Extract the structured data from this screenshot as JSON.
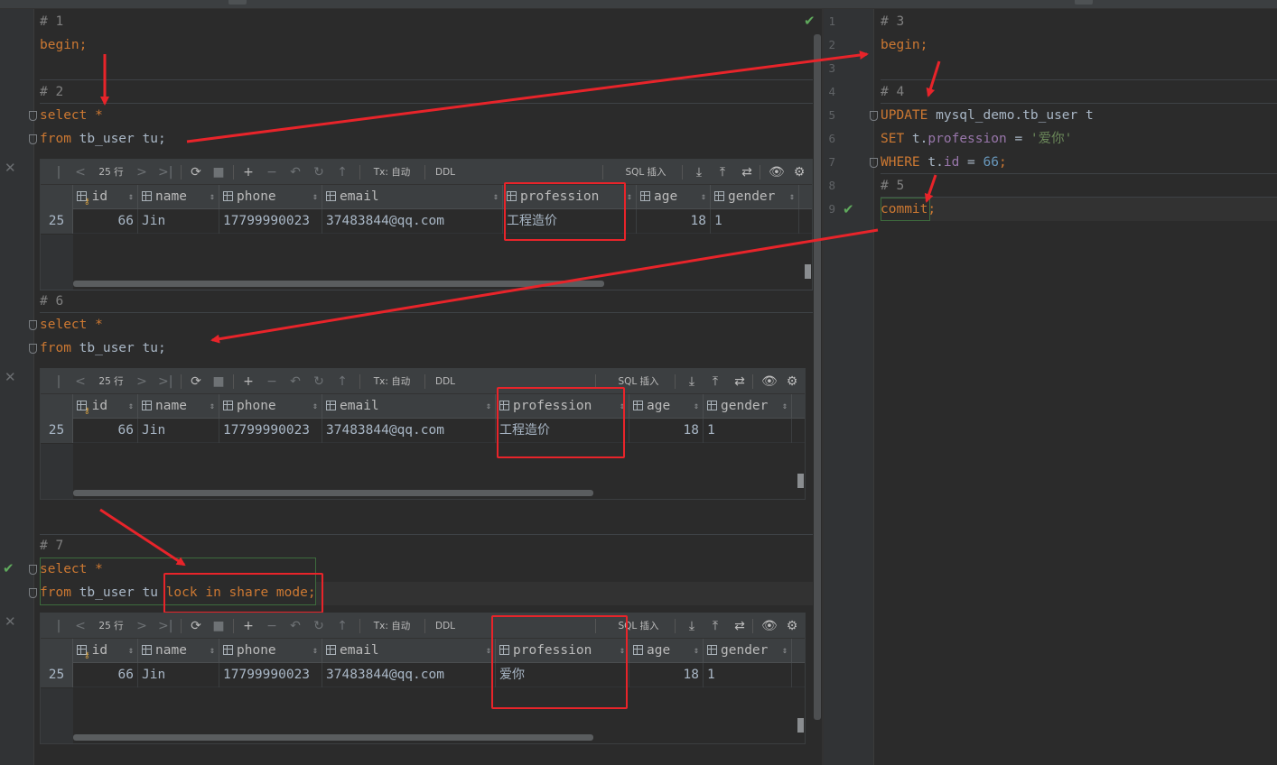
{
  "editor_left": {
    "block1": {
      "comment": "# 1",
      "line": "begin;"
    },
    "block2": {
      "comment": "# 2",
      "line1_kw": "select",
      "line1_rest": " *",
      "line2_kw": "from",
      "line2_rest": " tb_user tu;"
    },
    "block6": {
      "comment": "# 6",
      "line1_kw": "select",
      "line1_rest": " *",
      "line2_kw": "from",
      "line2_rest": " tb_user tu;"
    },
    "block7": {
      "comment": "# 7",
      "line1_kw": "select",
      "line1_rest": " *",
      "line2_kw": "from",
      "line2_rest": " tb_user tu ",
      "line2_lock": "lock in share mode",
      "line2_end": ";"
    }
  },
  "editor_right": {
    "line_numbers": [
      "1",
      "2",
      "3",
      "4",
      "5",
      "6",
      "7",
      "8",
      "9"
    ],
    "block3": {
      "comment": "# 3",
      "line": "begin;"
    },
    "block4": {
      "comment": "# 4",
      "update_kw": "UPDATE",
      "update_rest": " mysql_demo.tb_user t",
      "set_kw": "SET",
      "set_t": " t.",
      "set_field": "profession",
      "set_eq": " = ",
      "set_value": "'爱你'",
      "where_kw": "WHERE",
      "where_t": " t.",
      "where_field": "id",
      "where_eq": " = ",
      "where_value": "66",
      "where_end": ";"
    },
    "block5": {
      "comment": "# 5",
      "line": "commit",
      "line_end": ";"
    }
  },
  "toolbar": {
    "first": "|<",
    "prev": "<",
    "rows": "25 行",
    "next": ">",
    "last": ">|",
    "refresh": "⟳",
    "stop": "■",
    "add": "+",
    "remove": "−",
    "revert": "↶",
    "submit": "↻",
    "up": "↑",
    "tx": "Tx: 自动",
    "ddl": "DDL",
    "sql": "SQL 插入",
    "export": "⤓",
    "import": "⤒",
    "compare": "⇄",
    "view": "👁",
    "settings": "⚙"
  },
  "columns": [
    "id",
    "name",
    "phone",
    "email",
    "profession",
    "age",
    "gender"
  ],
  "grids": [
    {
      "row_no": "25",
      "id": "66",
      "name": "Jin",
      "phone": "17799990023",
      "email": "37483844@qq.com",
      "profession": "工程造价",
      "age": "18",
      "gender": "1"
    },
    {
      "row_no": "25",
      "id": "66",
      "name": "Jin",
      "phone": "17799990023",
      "email": "37483844@qq.com",
      "profession": "工程造价",
      "age": "18",
      "gender": "1"
    },
    {
      "row_no": "25",
      "id": "66",
      "name": "Jin",
      "phone": "17799990023",
      "email": "37483844@qq.com",
      "profession": "爱你",
      "age": "18",
      "gender": "1"
    }
  ],
  "colors": {
    "keyword": "#cc7832",
    "comment": "#808080",
    "string": "#6a8759",
    "number": "#6897bb",
    "field": "#9876aa",
    "annotation": "#e8242a",
    "check": "#5fa95c"
  }
}
